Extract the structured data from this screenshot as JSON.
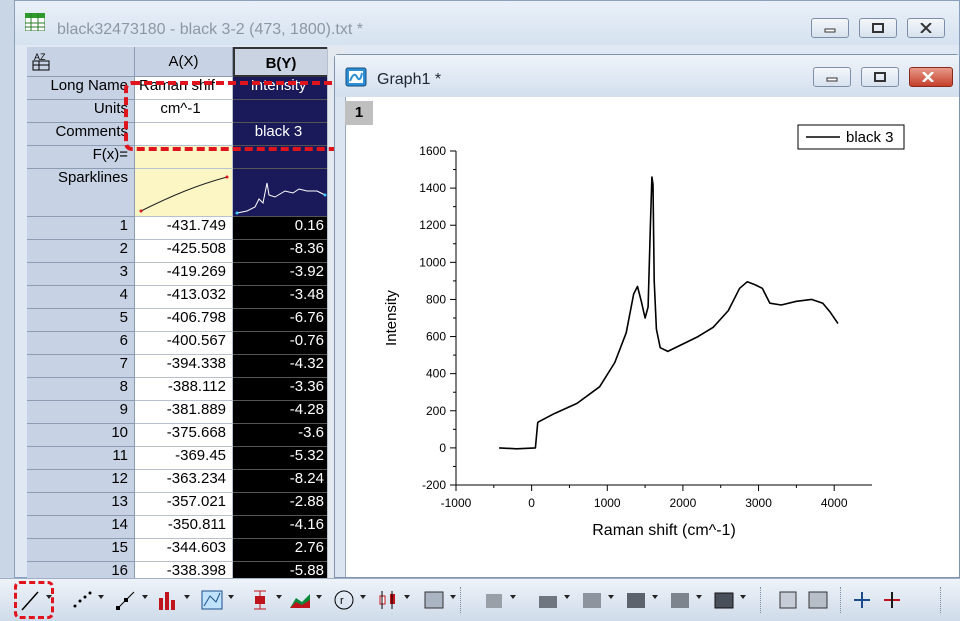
{
  "workbook": {
    "title": "black32473180 - black 3-2 (473, 1800).txt *",
    "columns": [
      {
        "header": "A(X)",
        "long_name": "Raman shif",
        "units": "cm^-1",
        "comments": ""
      },
      {
        "header": "B(Y)",
        "long_name": "Intensity",
        "units": "",
        "comments": "black 3"
      }
    ],
    "row_labels": {
      "long_name": "Long Name",
      "units": "Units",
      "comments": "Comments",
      "fx": "F(x)=",
      "sparklines": "Sparklines"
    },
    "rows": [
      {
        "n": "1",
        "a": "-431.749",
        "b": "0.16"
      },
      {
        "n": "2",
        "a": "-425.508",
        "b": "-8.36"
      },
      {
        "n": "3",
        "a": "-419.269",
        "b": "-3.92"
      },
      {
        "n": "4",
        "a": "-413.032",
        "b": "-3.48"
      },
      {
        "n": "5",
        "a": "-406.798",
        "b": "-6.76"
      },
      {
        "n": "6",
        "a": "-400.567",
        "b": "-0.76"
      },
      {
        "n": "7",
        "a": "-394.338",
        "b": "-4.32"
      },
      {
        "n": "8",
        "a": "-388.112",
        "b": "-3.36"
      },
      {
        "n": "9",
        "a": "-381.889",
        "b": "-4.28"
      },
      {
        "n": "10",
        "a": "-375.668",
        "b": "-3.6"
      },
      {
        "n": "11",
        "a": "-369.45",
        "b": "-5.32"
      },
      {
        "n": "12",
        "a": "-363.234",
        "b": "-8.24"
      },
      {
        "n": "13",
        "a": "-357.021",
        "b": "-2.88"
      },
      {
        "n": "14",
        "a": "-350.811",
        "b": "-4.16"
      },
      {
        "n": "15",
        "a": "-344.603",
        "b": "2.76"
      },
      {
        "n": "16",
        "a": "-338.398",
        "b": "-5.88"
      }
    ]
  },
  "graph": {
    "title": "Graph1 *",
    "layer": "1"
  },
  "chart_data": {
    "type": "line",
    "xlabel": "Raman shift (cm^-1)",
    "ylabel": "Intensity",
    "xlim": [
      -1000,
      4500
    ],
    "ylim": [
      -200,
      1600
    ],
    "xticks": [
      -1000,
      0,
      1000,
      2000,
      3000,
      4000
    ],
    "yticks": [
      -200,
      0,
      200,
      400,
      600,
      800,
      1000,
      1200,
      1400,
      1600
    ],
    "grid": false,
    "legend": "top-right",
    "series": [
      {
        "name": "black 3",
        "color": "#000000",
        "x": [
          -430,
          -200,
          50,
          80,
          90,
          300,
          600,
          900,
          1100,
          1250,
          1350,
          1400,
          1450,
          1500,
          1540,
          1570,
          1590,
          1605,
          1620,
          1650,
          1700,
          1800,
          2000,
          2200,
          2400,
          2600,
          2750,
          2850,
          2950,
          3050,
          3150,
          3300,
          3500,
          3700,
          3850,
          3950,
          4050
        ],
        "y": [
          0,
          -5,
          0,
          135,
          140,
          185,
          240,
          330,
          460,
          620,
          830,
          870,
          790,
          700,
          760,
          1200,
          1460,
          1420,
          900,
          640,
          540,
          520,
          560,
          600,
          650,
          740,
          860,
          895,
          880,
          860,
          780,
          770,
          790,
          800,
          780,
          730,
          670
        ]
      }
    ]
  },
  "toolbar": {
    "tools": [
      "line-tool",
      "scatter-tool",
      "line-symbol-tool",
      "column-tool",
      "contour-tool",
      "error-bar-tool",
      "area-tool",
      "polar-tool",
      "box-chart-tool",
      "plot-template-tool",
      "3d-wall-tool",
      "3d-bar-tool",
      "3d-scatter-tool",
      "3d-surface-tool",
      "3d-wireframe-tool",
      "3d-color-map-tool",
      "image-tool",
      "merge-graph-tool",
      "axis-tool",
      "scale-tool"
    ]
  },
  "colors": {
    "highlight": "#e0141c",
    "selected_column": "#1a1a5a"
  }
}
